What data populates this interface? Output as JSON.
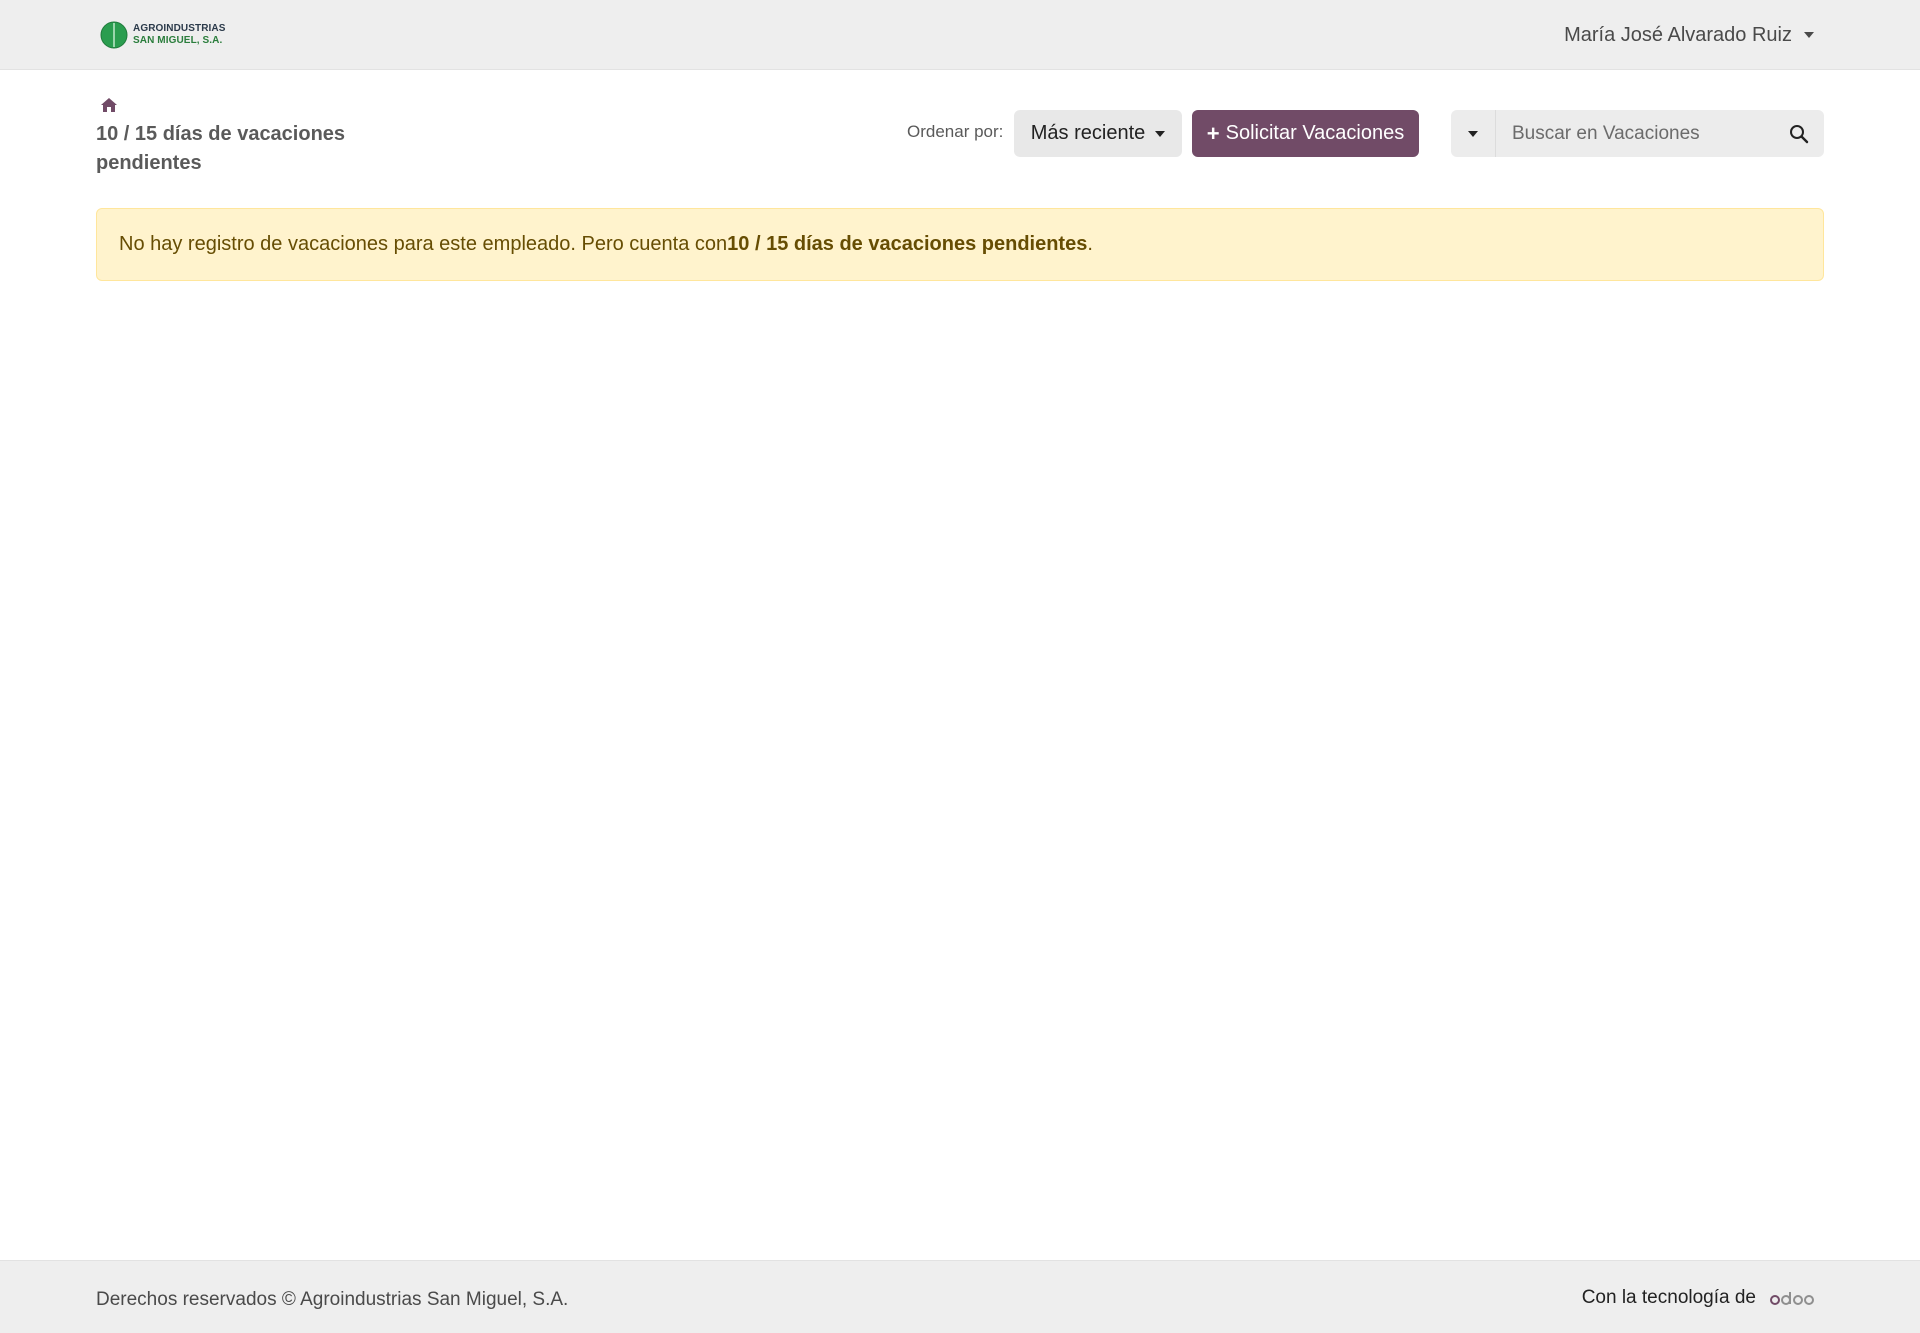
{
  "header": {
    "logo": {
      "line1": "AGROINDUSTRIAS",
      "line2": "SAN MIGUEL, S.A."
    },
    "user_name": "María José Alvarado Ruiz"
  },
  "page": {
    "title": "10 / 15 días de vacaciones pendientes"
  },
  "toolbar": {
    "sort_label": "Ordenar por:",
    "sort_value": "Más reciente",
    "request_button": "Solicitar Vacaciones",
    "search_placeholder": "Buscar en Vacaciones"
  },
  "alert": {
    "prefix": "No hay registro de vacaciones para este empleado. Pero cuenta con ",
    "bold": "10 / 15 días de vacaciones pendientes",
    "suffix": " ."
  },
  "footer": {
    "copyright": "Derechos reservados © Agroindustrias San Miguel, S.A.",
    "powered_by": "Con la tecnología de",
    "powered_logo": "odoo"
  },
  "colors": {
    "brand": "#714b67",
    "alert_bg": "#fff3cd",
    "alert_text": "#664d03",
    "logo_green": "#2a9d4f"
  },
  "icons": {
    "home": "home-icon",
    "search": "search-icon",
    "caret": "caret-down-icon",
    "plus": "plus-icon"
  }
}
